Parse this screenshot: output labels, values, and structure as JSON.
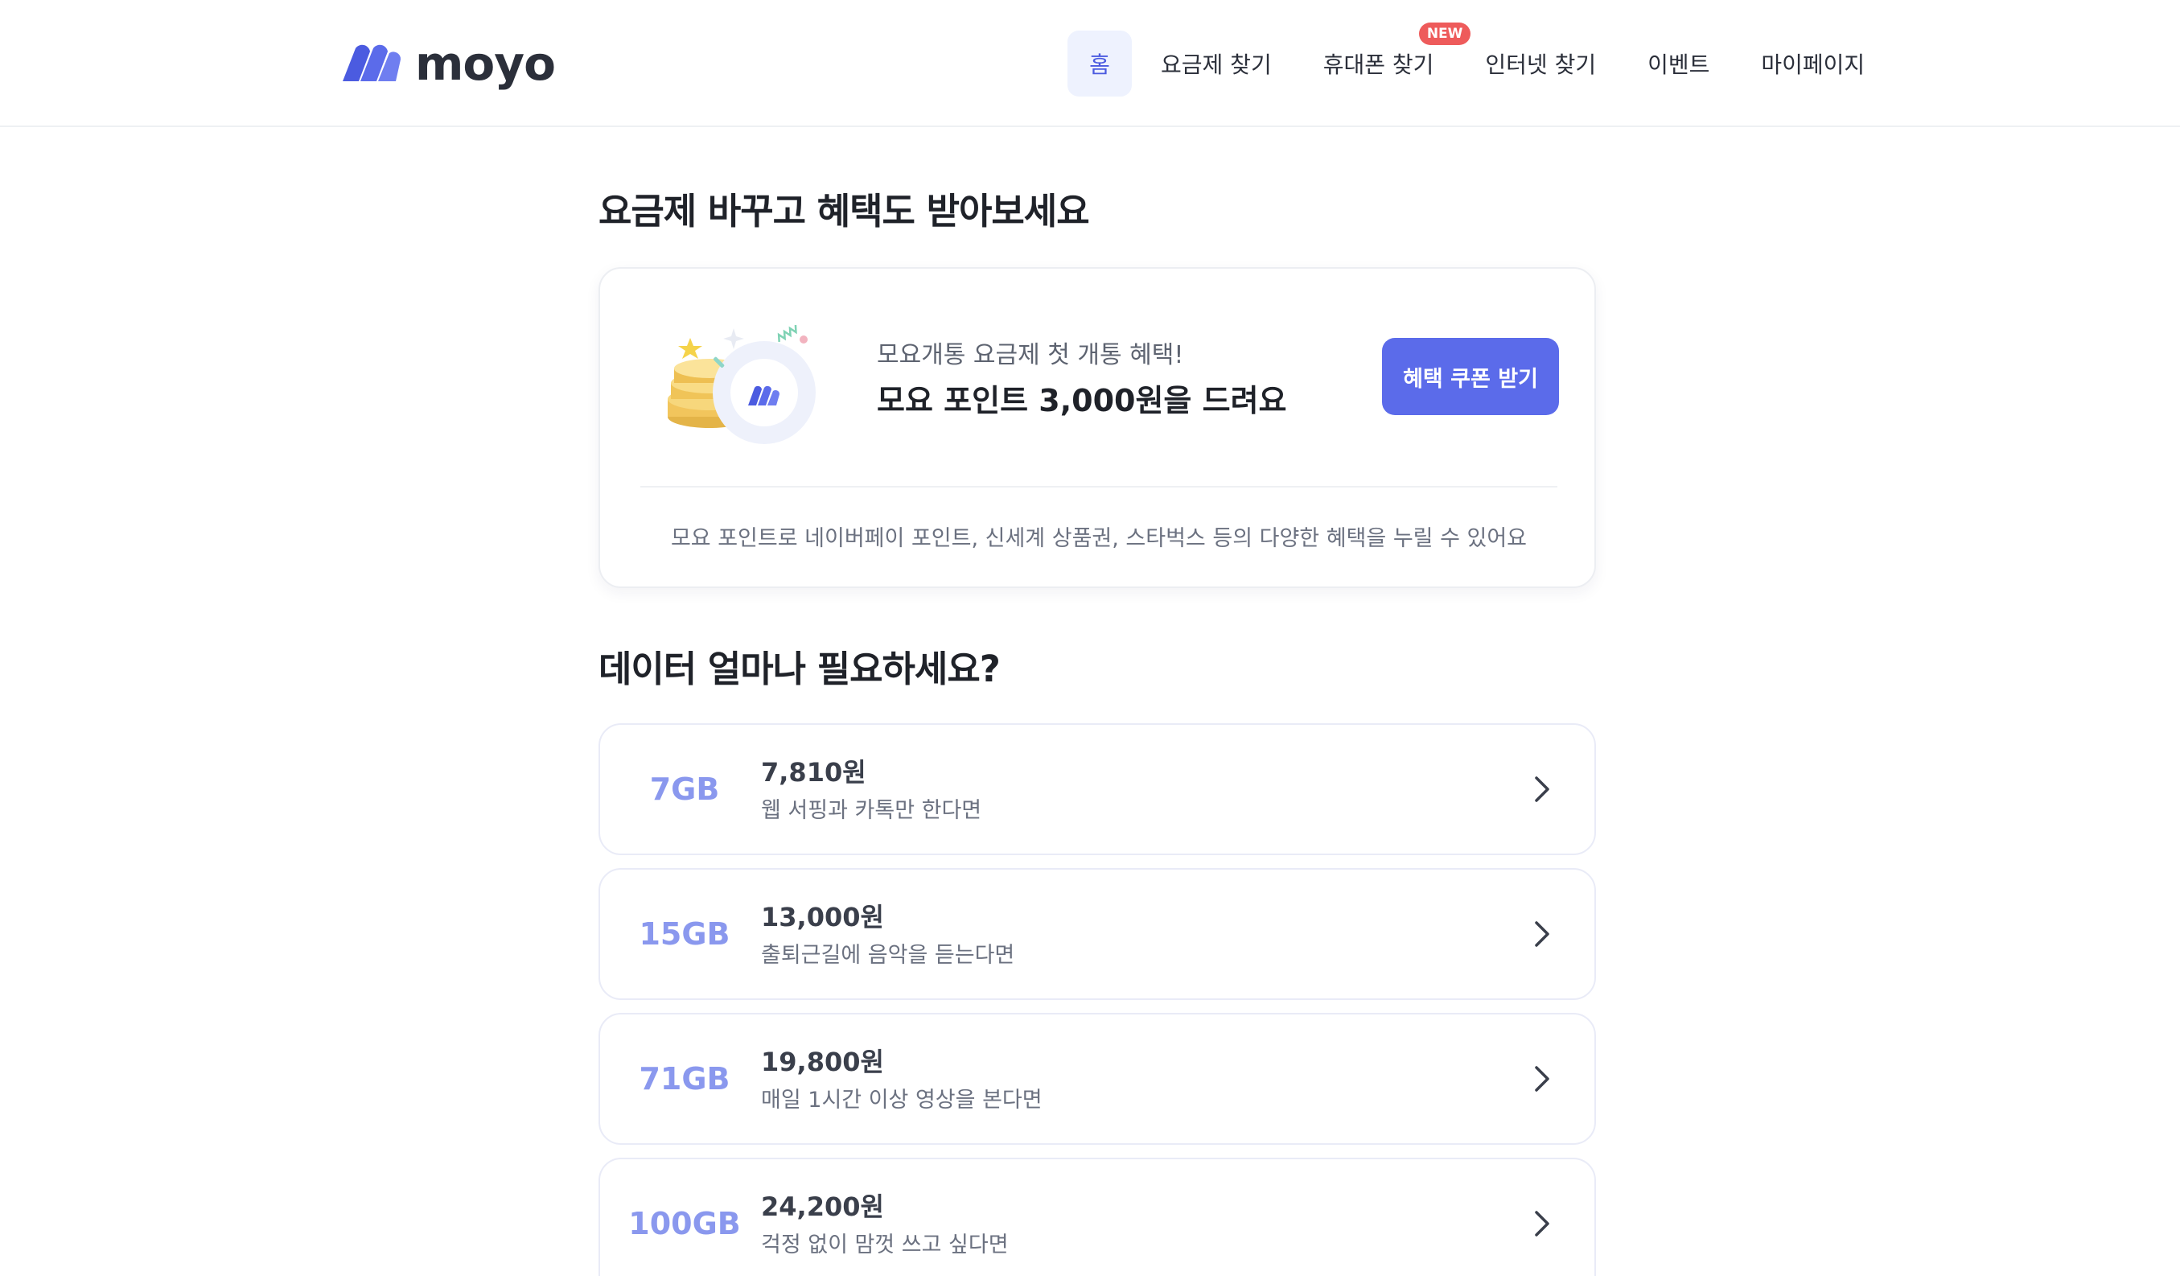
{
  "brand": {
    "name": "moyo",
    "accent": "#5b6bea"
  },
  "nav": {
    "items": [
      {
        "label": "홈",
        "active": true
      },
      {
        "label": "요금제 찾기"
      },
      {
        "label": "휴대폰 찾기",
        "badge": "NEW"
      },
      {
        "label": "인터넷 찾기"
      },
      {
        "label": "이벤트"
      },
      {
        "label": "마이페이지"
      }
    ]
  },
  "promo": {
    "title": "요금제 바꾸고 혜택도 받아보세요",
    "subtitle": "모요개통 요금제 첫 개통 혜택!",
    "headline": "모요 포인트 3,000원을 드려요",
    "button_label": "혜택 쿠폰 받기",
    "note": "모요 포인트로 네이버페이 포인트, 신세계 상품권, 스타벅스 등의 다양한 혜택을 누릴 수 있어요"
  },
  "data_section": {
    "title": "데이터 얼마나 필요하세요?",
    "plans": [
      {
        "gb": "7GB",
        "price": "7,810원",
        "desc": "웹 서핑과 카톡만 한다면"
      },
      {
        "gb": "15GB",
        "price": "13,000원",
        "desc": "출퇴근길에 음악을 듣는다면"
      },
      {
        "gb": "71GB",
        "price": "19,800원",
        "desc": "매일 1시간 이상 영상을 본다면"
      },
      {
        "gb": "100GB",
        "price": "24,200원",
        "desc": "걱정 없이 맘껏 쓰고 싶다면"
      }
    ]
  },
  "icons": {
    "logo": "moyo-logo-icon",
    "promo": "coin-illustration-icon",
    "arrow": "chevron-right-icon"
  }
}
